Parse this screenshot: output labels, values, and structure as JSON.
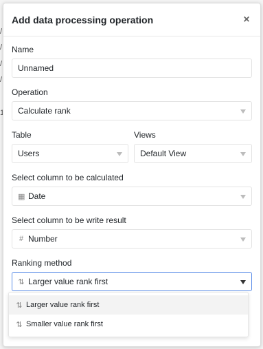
{
  "background": {
    "marks": [
      "/",
      "/",
      "/",
      "/",
      "1"
    ]
  },
  "dialog": {
    "title": "Add data processing operation",
    "close_icon": "close-icon"
  },
  "form": {
    "name": {
      "label": "Name",
      "value": "Unnamed"
    },
    "operation": {
      "label": "Operation",
      "value": "Calculate rank"
    },
    "table": {
      "label": "Table",
      "value": "Users"
    },
    "views": {
      "label": "Views",
      "value": "Default View"
    },
    "calc_column": {
      "label": "Select column to be calculated",
      "value": "Date",
      "icon": "calendar-icon"
    },
    "result_column": {
      "label": "Select column to be write result",
      "value": "Number",
      "icon": "hash-icon"
    },
    "ranking_method": {
      "label": "Ranking method",
      "value": "Larger value rank first",
      "icon": "sort-desc-icon"
    }
  },
  "dropdown": {
    "options": [
      {
        "label": "Larger value rank first",
        "icon": "sort-desc-icon"
      },
      {
        "label": "Smaller value rank first",
        "icon": "sort-asc-icon"
      }
    ]
  }
}
